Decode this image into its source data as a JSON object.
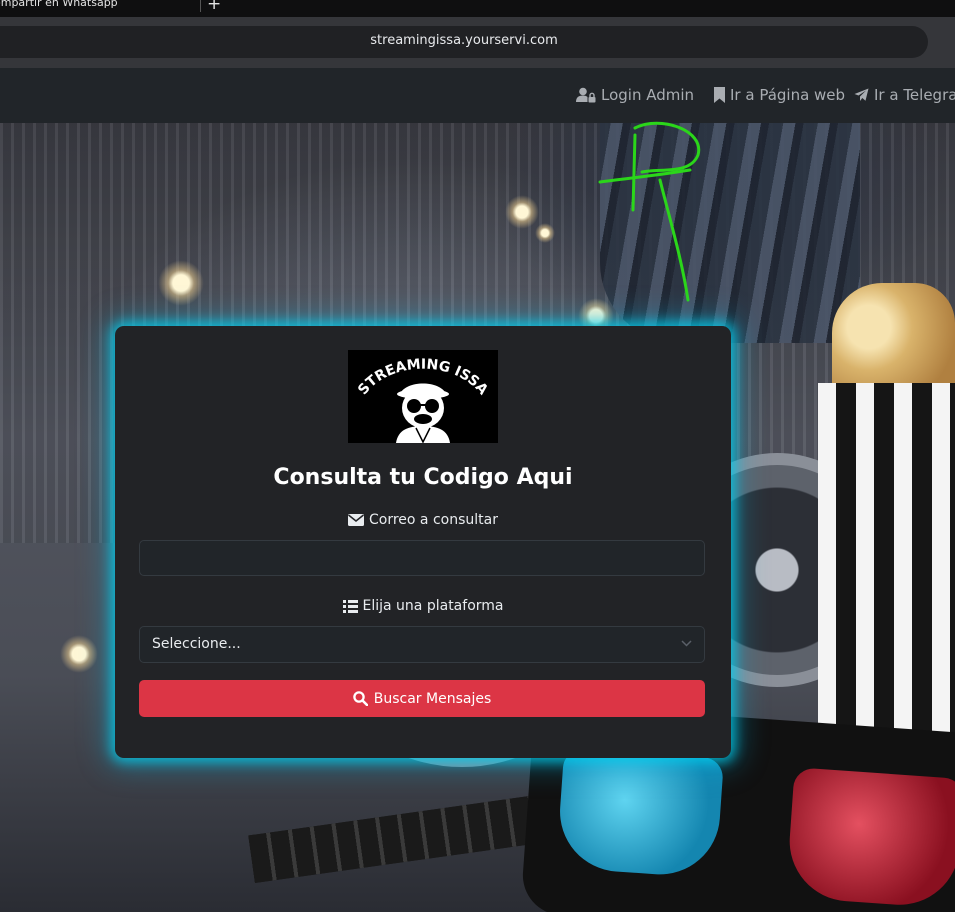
{
  "browser": {
    "tab_title": "ompartir en Whatsapp",
    "new_tab_symbol": "+",
    "url": "streamingissa.yourservi.com"
  },
  "navbar": {
    "links": [
      {
        "label": "Login Admin",
        "icon": "user-lock-icon"
      },
      {
        "label": "Ir a Página web",
        "icon": "bookmark-icon"
      },
      {
        "label": "Ir a Telegram",
        "icon": "telegram-plane-icon"
      }
    ]
  },
  "card": {
    "logo_text": "STREAMING ISSA",
    "title": "Consulta tu Codigo Aqui",
    "email_label": "Correo a consultar",
    "email_icon": "envelope-icon",
    "email_value": "",
    "platform_label": "Elija una plataforma",
    "platform_icon": "list-icon",
    "platform_selected": "Seleccione...",
    "search_button": "Buscar Mensajes",
    "search_icon": "search-icon"
  },
  "colors": {
    "accent_glow": "#00d2f0",
    "button_red": "#dc3545",
    "card_bg": "#222326",
    "navbar_bg": "#212529"
  }
}
